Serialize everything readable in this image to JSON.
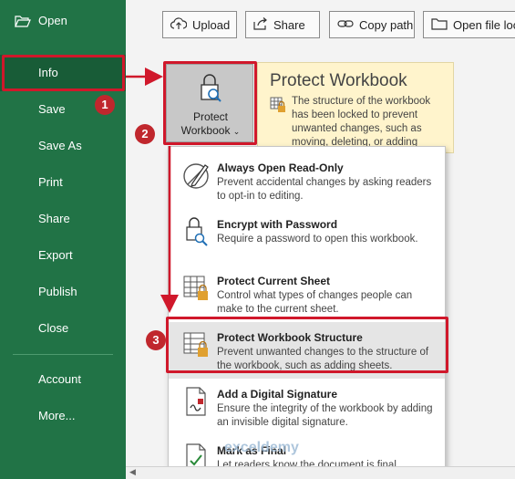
{
  "sidebar": {
    "items": [
      {
        "label": "Open"
      },
      {
        "label": "Info"
      },
      {
        "label": "Save"
      },
      {
        "label": "Save As"
      },
      {
        "label": "Print"
      },
      {
        "label": "Share"
      },
      {
        "label": "Export"
      },
      {
        "label": "Publish"
      },
      {
        "label": "Close"
      },
      {
        "label": "Account"
      },
      {
        "label": "More..."
      }
    ]
  },
  "toolbar": {
    "upload": "Upload",
    "share": "Share",
    "copy_path": "Copy path",
    "open_file_location": "Open file loca"
  },
  "protect": {
    "button_line1": "Protect",
    "button_line2": "Workbook",
    "title": "Protect Workbook",
    "description": "The structure of the workbook has been locked to prevent unwanted changes, such as moving, deleting, or adding"
  },
  "menu": {
    "items": [
      {
        "title": "Always Open Read-Only",
        "desc": "Prevent accidental changes by asking readers to opt-in to editing."
      },
      {
        "title": "Encrypt with Password",
        "desc": "Require a password to open this workbook."
      },
      {
        "title": "Protect Current Sheet",
        "desc": "Control what types of changes people can make to the current sheet."
      },
      {
        "title": "Protect Workbook Structure",
        "desc": "Prevent unwanted changes to the structure of the workbook, such as adding sheets."
      },
      {
        "title": "Add a Digital Signature",
        "desc": "Ensure the integrity of the workbook by adding an invisible digital signature."
      },
      {
        "title": "Mark as Final",
        "desc": "Let readers know the document is final."
      }
    ]
  },
  "steps": {
    "s1": "1",
    "s2": "2",
    "s3": "3"
  },
  "watermark": "exceldemy",
  "colors": {
    "sidebar": "#217346",
    "sidebar_active": "#185c37",
    "annotation": "#d0182b",
    "panel": "#fff4cc"
  }
}
